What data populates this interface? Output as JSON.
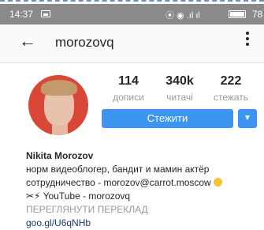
{
  "status_bar": {
    "time": "14:37",
    "signal_text": "⦿ ◉ .ıl ıl",
    "battery": "78"
  },
  "header": {
    "username": "morozovq",
    "back_icon": "←"
  },
  "stats": [
    {
      "value": "114",
      "label": "дописи"
    },
    {
      "value": "340k",
      "label": "читачі"
    },
    {
      "value": "222",
      "label": "стежать"
    }
  ],
  "follow_button": "Стежити",
  "dropdown_glyph": "▼",
  "bio": {
    "name": "Nikita Morozov",
    "line1": "норм видеоблогер, бандит и мамин актёр",
    "line2": "сотрудничество - morozov@carrot.moscow",
    "line3_prefix": "✂⚡",
    "line3": " YouTube - morozovq",
    "translate": "ПЕРЕГЛЯНУТИ ПЕРЕКЛАД",
    "link": "goo.gl/U6qNHb"
  },
  "colors": {
    "accent": "#3e95ef",
    "avatar_bg": "#d94737"
  }
}
